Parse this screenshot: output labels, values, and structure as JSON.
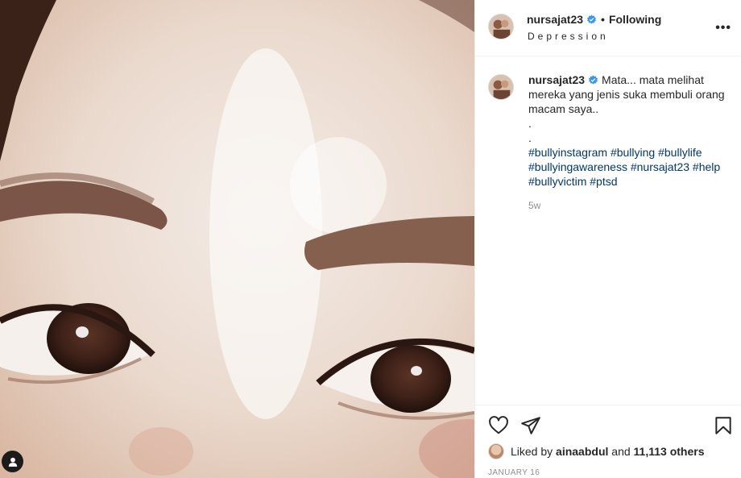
{
  "post": {
    "username": "nursajat23",
    "follow_status": "Following",
    "location": "Depression",
    "more_label": "•••",
    "caption": {
      "username": "nursajat23",
      "text": "Mata... mata melihat mereka yang jenis suka membuli orang macam saya..\n.\n.",
      "hashtags": [
        "#bullyinstagram",
        "#bullying",
        "#bullylife",
        "#bullyingawareness",
        "#nursajat23",
        "#help",
        "#bullyvictim",
        "#ptsd"
      ],
      "age": "5w"
    },
    "likes": {
      "prefix": "Liked by",
      "liker": "ainaabdul",
      "conjunction": "and",
      "others": "11,113 others"
    },
    "date": "JANUARY 16"
  },
  "icons": {
    "verified": "verified-badge-icon",
    "like": "heart-icon",
    "share": "paper-plane-icon",
    "save": "bookmark-icon",
    "tag": "user-tag-icon",
    "more": "more-options-icon"
  },
  "colors": {
    "link": "#00376b",
    "verified": "#3897f0",
    "muted": "#8e8e8e",
    "text": "#262626",
    "border": "#efefef"
  }
}
